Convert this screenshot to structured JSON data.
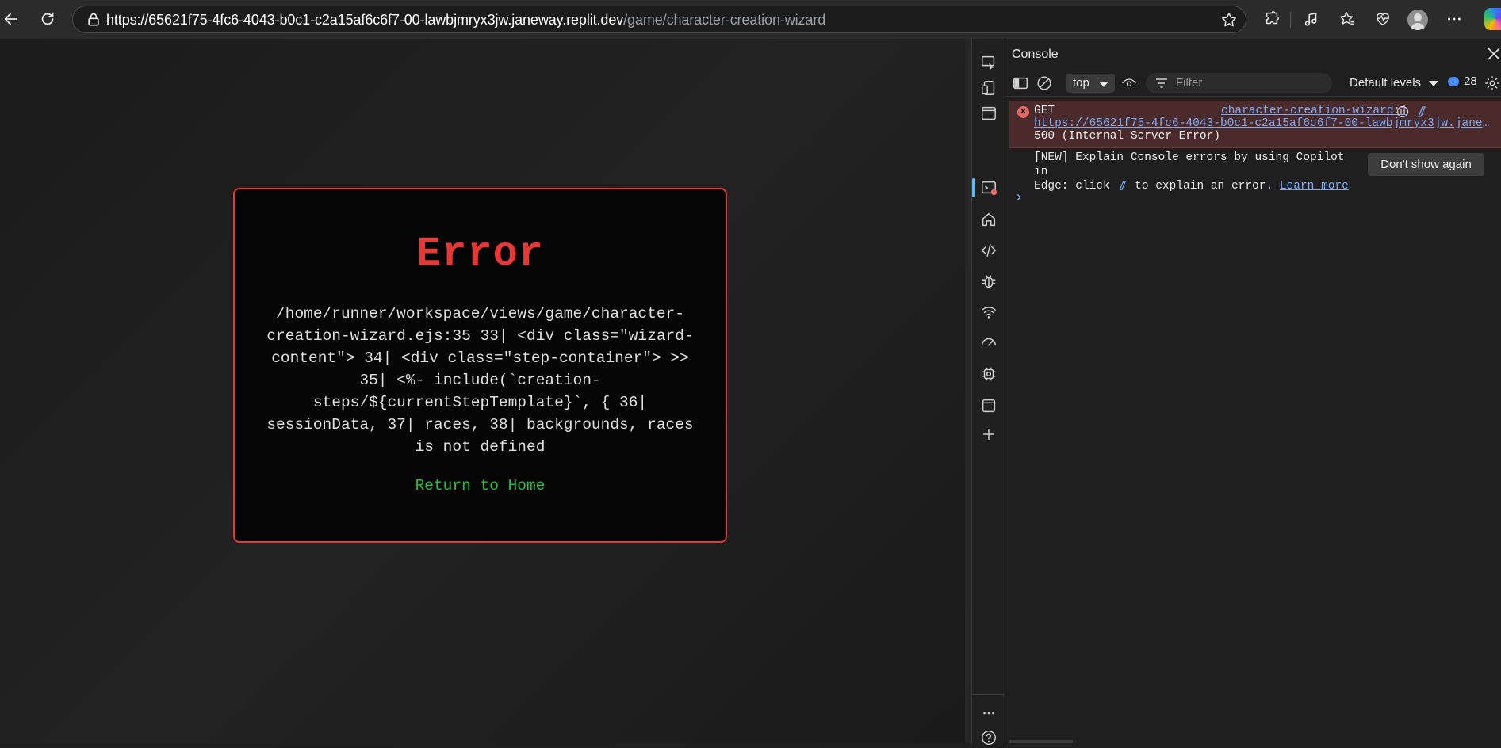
{
  "browser": {
    "url_host": "https://65621f75-4fc6-4043-b0c1-c2a15af6c6f7-00-lawbjmryx3jw.janeway.replit.dev",
    "url_path": "/game/character-creation-wizard"
  },
  "page": {
    "error_title": "Error",
    "error_message": "/home/runner/workspace/views/game/character-creation-wizard.ejs:35 33| <div class=\"wizard-content\"> 34| <div class=\"step-container\"> >> 35| <%- include(`creation-steps/${currentStepTemplate}`, { 36| sessionData, 37| races, 38| backgrounds, races is not defined",
    "return_link": "Return to Home"
  },
  "devtools": {
    "panel_title": "Console",
    "context": "top",
    "filter_placeholder": "Filter",
    "levels": "Default levels",
    "issue_count": "28",
    "error": {
      "method": "GET",
      "source": "character-creation-wizard:1",
      "url": "https://65621f75-4fc6-4043-b0c1-c2a15af6c6f7-00-lawbjmryx3jw.janeway.replit.dev/game/character-creation-wizard",
      "status": "500 (Internal Server Error)"
    },
    "copilot": {
      "line1": "[NEW] Explain Console errors by using Copilot in",
      "line2a": "Edge: click",
      "line2b": "to explain an error.",
      "learn_more": "Learn more",
      "dismiss": "Don't show again"
    },
    "prompt_symbol": "›"
  },
  "colors": {
    "accent_error": "#e53935",
    "link_green": "#20c040",
    "devtools_link": "#7cacf8"
  }
}
